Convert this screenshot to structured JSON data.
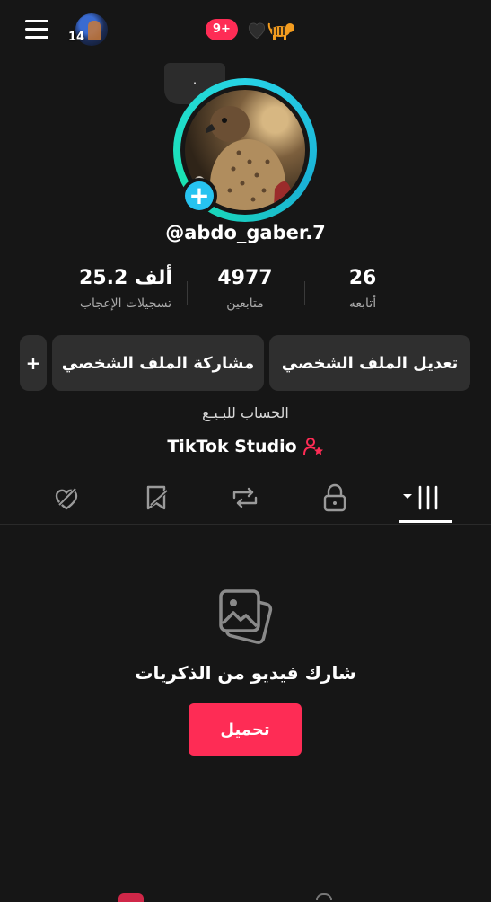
{
  "topbar": {
    "avatar_count": "14",
    "notification_badge": "9+"
  },
  "profile": {
    "story_bubble_text": "٠",
    "username": "@abdo_gaber.7",
    "stats": [
      {
        "value": "26",
        "label": "أتابعه"
      },
      {
        "value": "4977",
        "label": "متابعين"
      },
      {
        "value": "25.2 ألف",
        "label": "تسجيلات الإعجاب"
      }
    ],
    "buttons": {
      "edit": "تعديل الملف الشخصي",
      "share": "مشاركة الملف الشخصي",
      "add_friend": "+"
    },
    "bio": "الحساب للبـيـع",
    "studio_link": "TikTok Studio"
  },
  "tabs": [
    "videos-grid",
    "private",
    "reposts",
    "favorites",
    "liked"
  ],
  "empty_state": {
    "title": "شارك فيديو من الذكريات",
    "upload_button": "تحميل"
  },
  "colors": {
    "accent": "#fe2c55",
    "ring": "#27d3e7",
    "background": "#161616"
  }
}
